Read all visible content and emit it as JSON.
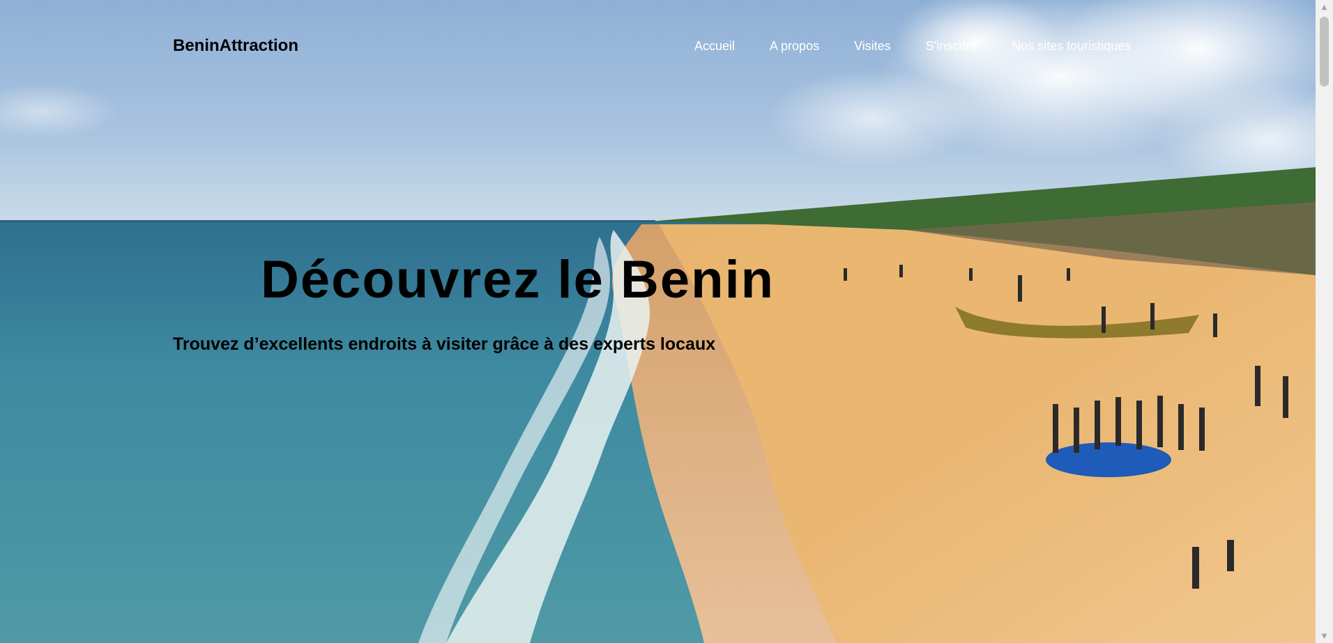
{
  "header": {
    "brand": "BeninAttraction",
    "nav": [
      "Accueil",
      "A propos",
      "Visites",
      "S'inscrire",
      "Nos sites touristiques"
    ]
  },
  "hero": {
    "title": "Découvrez le Benin",
    "subtitle": "Trouvez d’excellents endroits à visiter grâce à des experts locaux",
    "image": "beach-photo"
  },
  "scrollbar": {
    "up_icon": "scroll-up-arrow-icon",
    "down_icon": "scroll-down-arrow-icon"
  }
}
